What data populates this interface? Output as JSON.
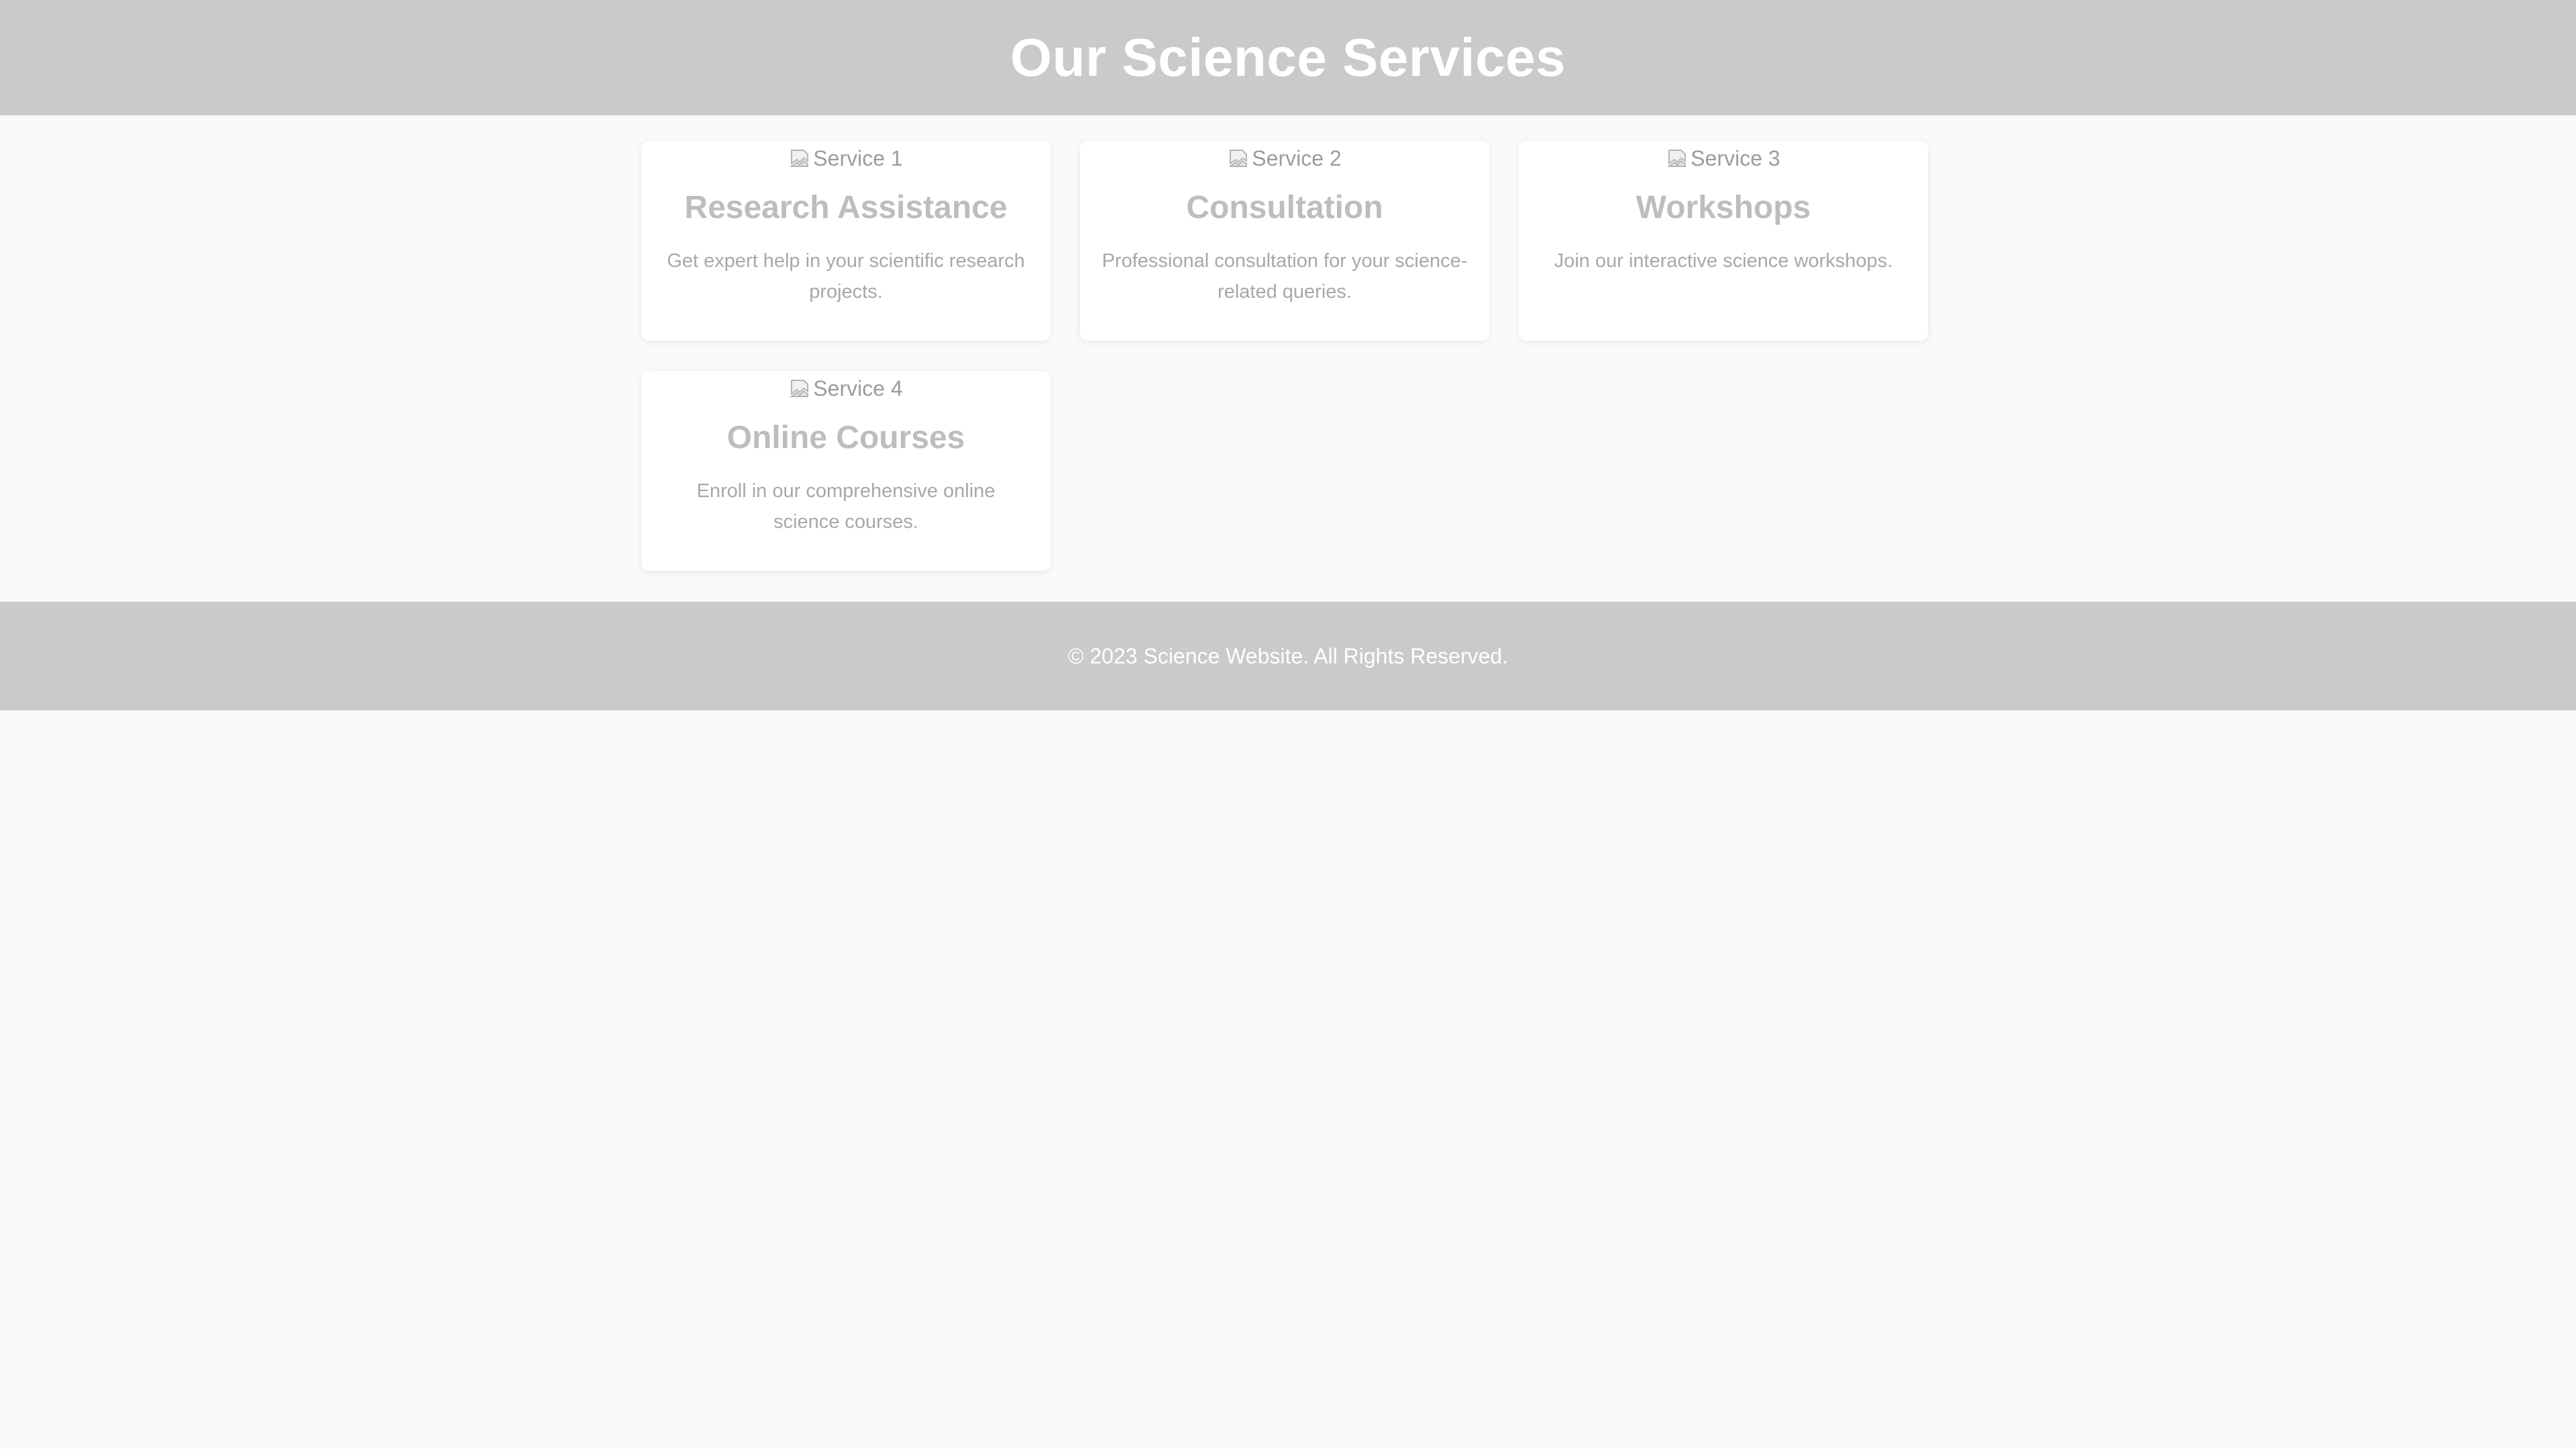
{
  "header": {
    "title": "Our Science Services"
  },
  "services": [
    {
      "image_alt": "Service 1",
      "title": "Research Assistance",
      "description": "Get expert help in your scientific research projects."
    },
    {
      "image_alt": "Service 2",
      "title": "Consultation",
      "description": "Professional consultation for your science-related queries."
    },
    {
      "image_alt": "Service 3",
      "title": "Workshops",
      "description": "Join our interactive science workshops."
    },
    {
      "image_alt": "Service 4",
      "title": "Online Courses",
      "description": "Enroll in our comprehensive online science courses."
    }
  ],
  "footer": {
    "copyright": "© 2023 Science Website. All Rights Reserved."
  },
  "colors": {
    "header_bg": "#cacaca",
    "page_bg": "#fafafa",
    "card_bg": "#ffffff",
    "title_text": "#bdbdbd",
    "body_text": "#a8a8a8"
  },
  "icons": {
    "service_image": "broken-image-icon"
  }
}
